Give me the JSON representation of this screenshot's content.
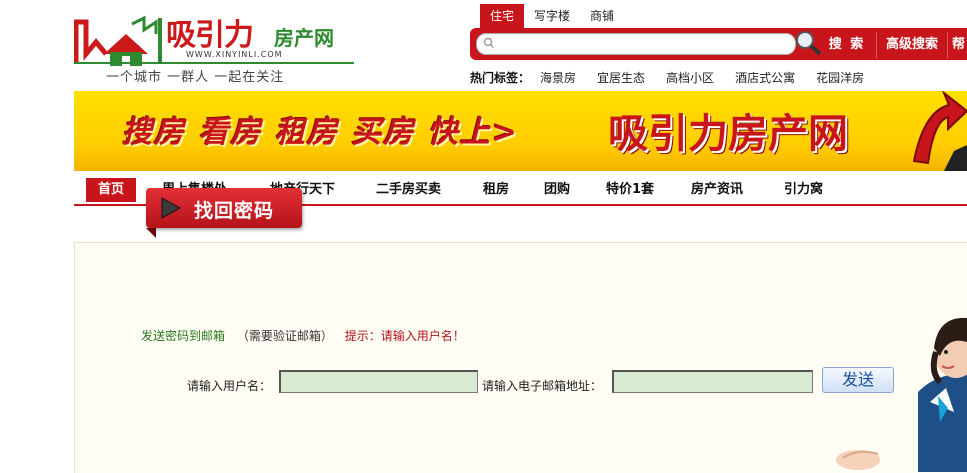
{
  "logo": {
    "title": "吸引力",
    "subtitle": "房产网",
    "url": "WWW.XINYINLI.COM",
    "slogan": "一个城市  一群人  一起在关注"
  },
  "search": {
    "tabs": [
      "住宅",
      "写字楼",
      "商铺"
    ],
    "active_tab": 0,
    "placeholder": "",
    "search_label": "搜 索",
    "advanced_label": "高级搜索",
    "more_label": "帮"
  },
  "hot_tags": {
    "label": "热门标签：",
    "tags": [
      "海景房",
      "宜居生态",
      "高档小区",
      "酒店式公寓",
      "花园洋房"
    ]
  },
  "banner": {
    "slogan": "搜房 看房 租房 买房 快上>",
    "brand": "吸引力房产网"
  },
  "nav": {
    "items": [
      "首页",
      "周上售楼处",
      "地产行天下",
      "二手房买卖",
      "租房",
      "团购",
      "特价1套",
      "房产资讯",
      "引力窝"
    ]
  },
  "badge": {
    "label": "找回密码"
  },
  "form": {
    "send_to_email": "发送密码到邮箱",
    "need_verify": "（需要验证邮箱）",
    "hint": "提示：请输入用户名！",
    "username_label": "请输入用户名：",
    "username_value": "",
    "email_label": "请输入电子邮箱地址：",
    "email_value": "",
    "send_button": "发送"
  },
  "colors": {
    "brand_red": "#c8151b",
    "banner_yellow": "#ffd400",
    "input_green": "#d9ead3",
    "text_green": "#2a7a1e"
  }
}
